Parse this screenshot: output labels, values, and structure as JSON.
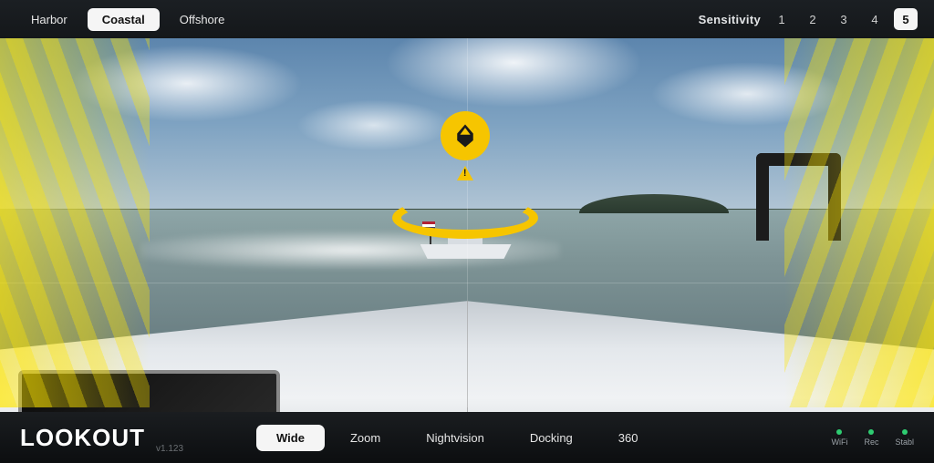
{
  "topbar": {
    "modes": [
      {
        "label": "Harbor",
        "active": false
      },
      {
        "label": "Coastal",
        "active": true
      },
      {
        "label": "Offshore",
        "active": false
      }
    ],
    "sensitivity_label": "Sensitivity",
    "sensitivity_levels": [
      "1",
      "2",
      "3",
      "4",
      "5"
    ],
    "sensitivity_active": "5"
  },
  "detection": {
    "icon": "ship-icon",
    "warning": true
  },
  "bottombar": {
    "logo": "LOOKOUT",
    "version": "v1.123",
    "views": [
      {
        "label": "Wide",
        "active": true
      },
      {
        "label": "Zoom",
        "active": false
      },
      {
        "label": "Nightvision",
        "active": false
      },
      {
        "label": "Docking",
        "active": false
      },
      {
        "label": "360",
        "active": false
      }
    ],
    "status": [
      {
        "label": "WiFi"
      },
      {
        "label": "Rec"
      },
      {
        "label": "Stabl"
      }
    ]
  },
  "colors": {
    "accent": "#f6c500",
    "ok": "#2ecc71"
  }
}
